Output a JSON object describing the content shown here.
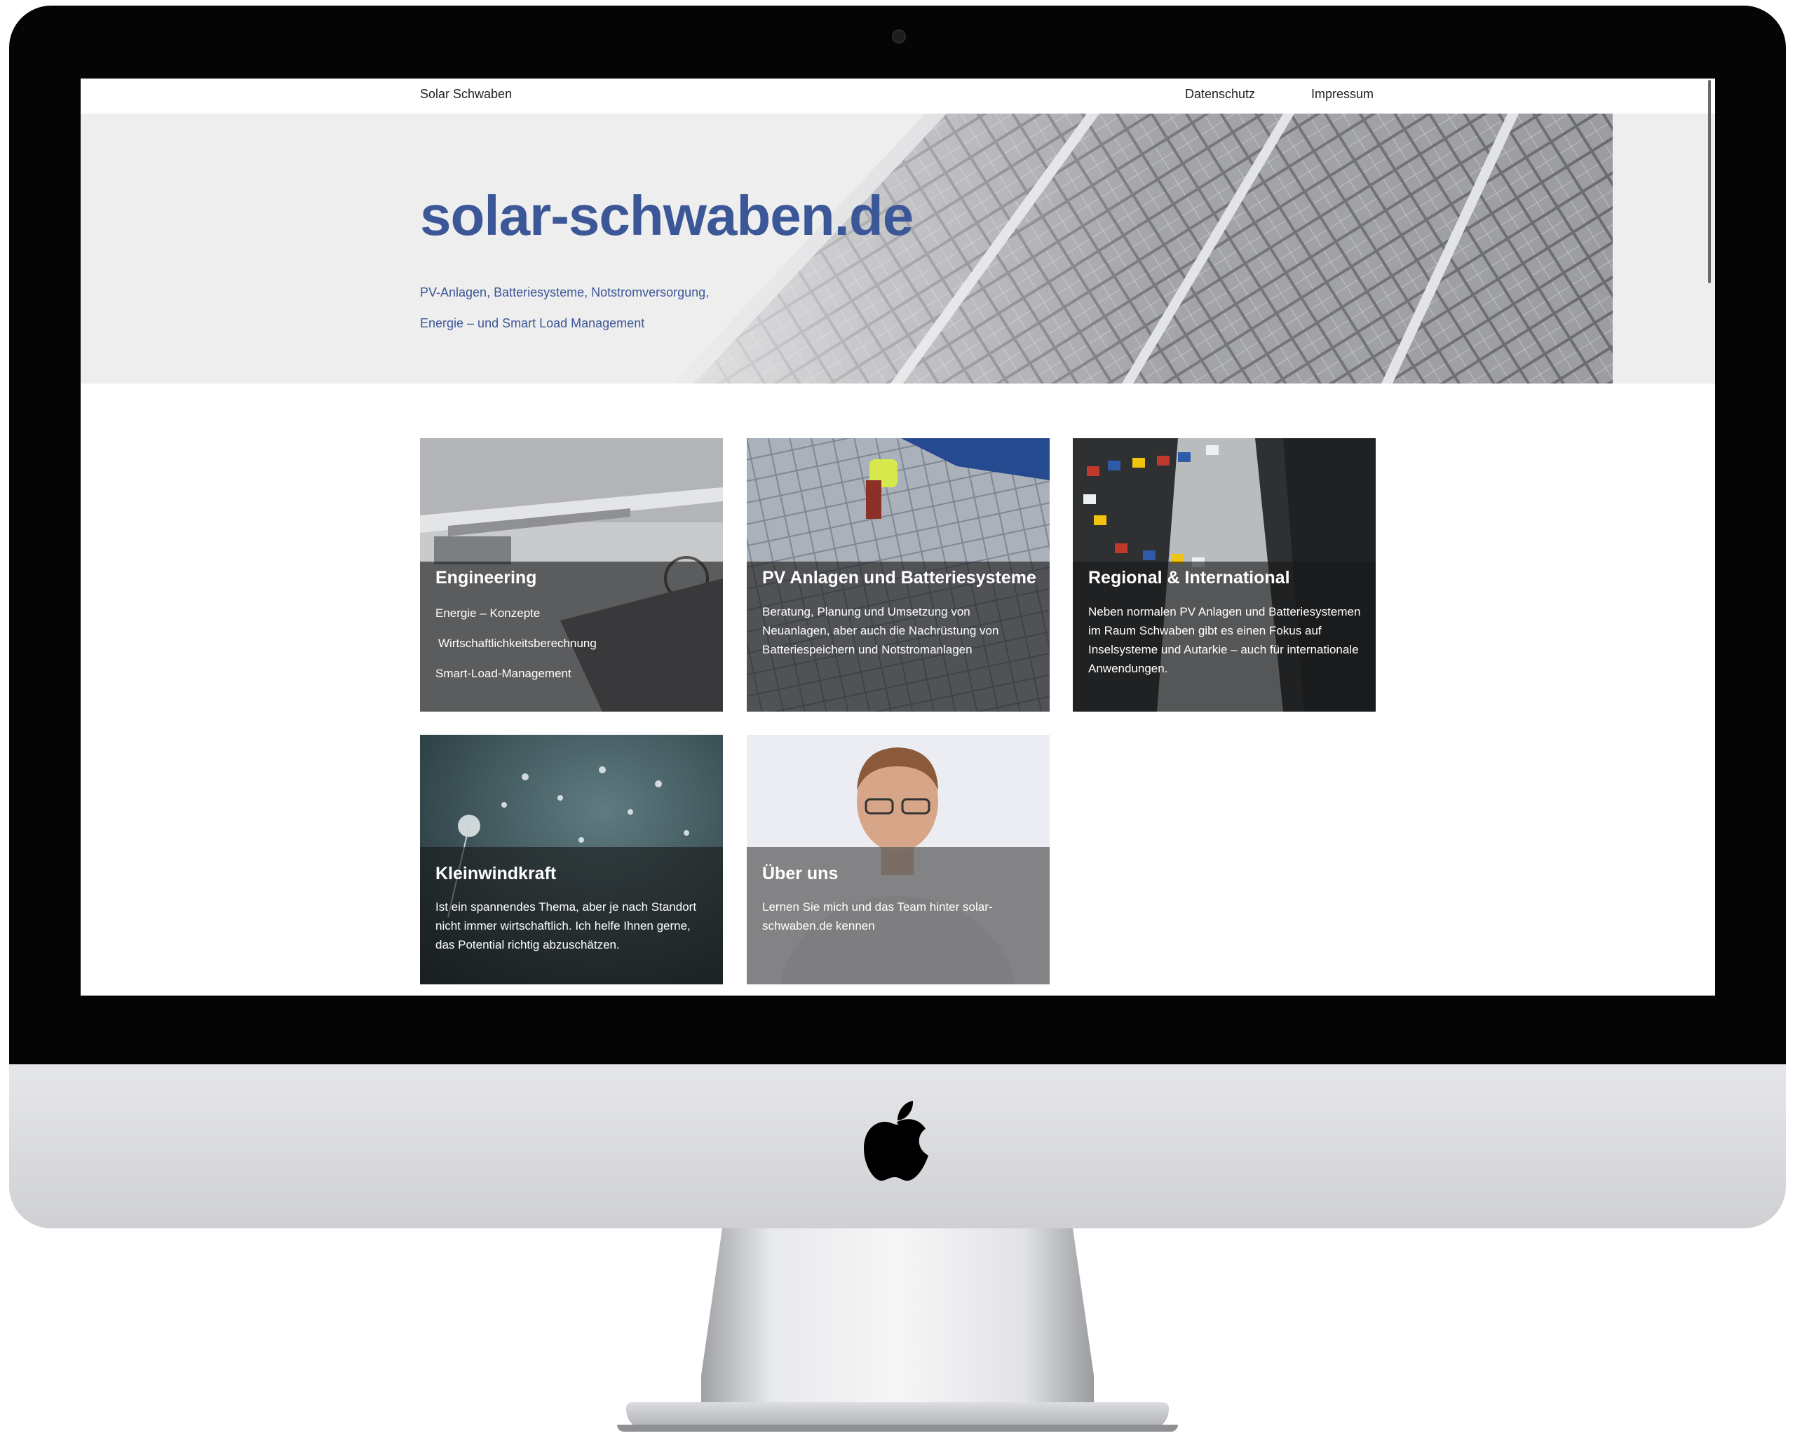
{
  "site": {
    "brand": "Solar Schwaben",
    "nav": [
      {
        "label": "Datenschutz"
      },
      {
        "label": "Impressum"
      }
    ]
  },
  "hero": {
    "title": "solar-schwaben.de",
    "subtitle_line1": "PV-Anlagen, Batteriesysteme, Notstromversorgung,",
    "subtitle_line2": "Energie – und Smart Load Management"
  },
  "cards": [
    {
      "title": "Engineering",
      "lines": [
        "Energie – Konzepte",
        "Wirtschaftlichkeitsberechnung",
        "Smart-Load-Management"
      ]
    },
    {
      "title": "PV Anlagen und Batteriesysteme",
      "text": "Beratung, Planung und Umsetzung von Neuanlagen, aber auch die Nachrüstung von Batteriespeichern und Notstromanlagen"
    },
    {
      "title": "Regional & International",
      "text": "Neben normalen PV Anlagen und Batteriesystemen im Raum Schwaben gibt es einen Fokus auf Inselsysteme und Autarkie – auch für internationale Anwendungen."
    },
    {
      "title": "Kleinwindkraft",
      "text": "Ist ein spannendes Thema, aber je nach Standort nicht immer wirtschaftlich. Ich helfe Ihnen gerne, das Potential richtig abzuschätzen."
    },
    {
      "title": "Über uns",
      "text": "Lernen Sie mich und das Team hinter solar-schwaben.de kennen"
    }
  ],
  "colors": {
    "brand_blue": "#3c5797",
    "bezel": "#050505",
    "card_overlay": "rgba(25,25,25,0.62)"
  },
  "icons": [
    "apple-logo-icon",
    "camera-icon"
  ]
}
